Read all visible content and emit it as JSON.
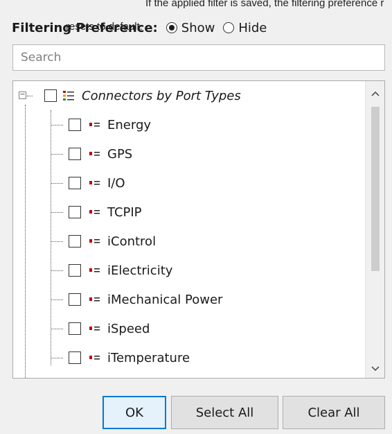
{
  "header": {
    "overlap_line1": "If the applied filter is saved, the filtering preference r",
    "overlap_line2": "resets to default."
  },
  "filter_pref": {
    "label": "Filtering Preference:",
    "options": [
      {
        "label": "Show",
        "selected": true
      },
      {
        "label": "Hide",
        "selected": false
      }
    ]
  },
  "search": {
    "placeholder": "Search",
    "value": ""
  },
  "tree": {
    "root": {
      "label": "Connectors by Port Types",
      "expanded": true,
      "checked": false
    },
    "items": [
      {
        "label": "Energy",
        "checked": false
      },
      {
        "label": "GPS",
        "checked": false
      },
      {
        "label": "I/O",
        "checked": false
      },
      {
        "label": "TCPIP",
        "checked": false
      },
      {
        "label": "iControl",
        "checked": false
      },
      {
        "label": "iElectricity",
        "checked": false
      },
      {
        "label": "iMechanical Power",
        "checked": false
      },
      {
        "label": "iSpeed",
        "checked": false
      },
      {
        "label": "iTemperature",
        "checked": false
      }
    ]
  },
  "buttons": {
    "ok": "OK",
    "select_all": "Select All",
    "clear_all": "Clear All"
  },
  "colors": {
    "accent": "#0078d7",
    "port_icon": "#c00000"
  },
  "icons": [
    "minus-box-icon",
    "list-group-icon",
    "port-type-icon",
    "scroll-up-icon",
    "scroll-down-icon"
  ]
}
